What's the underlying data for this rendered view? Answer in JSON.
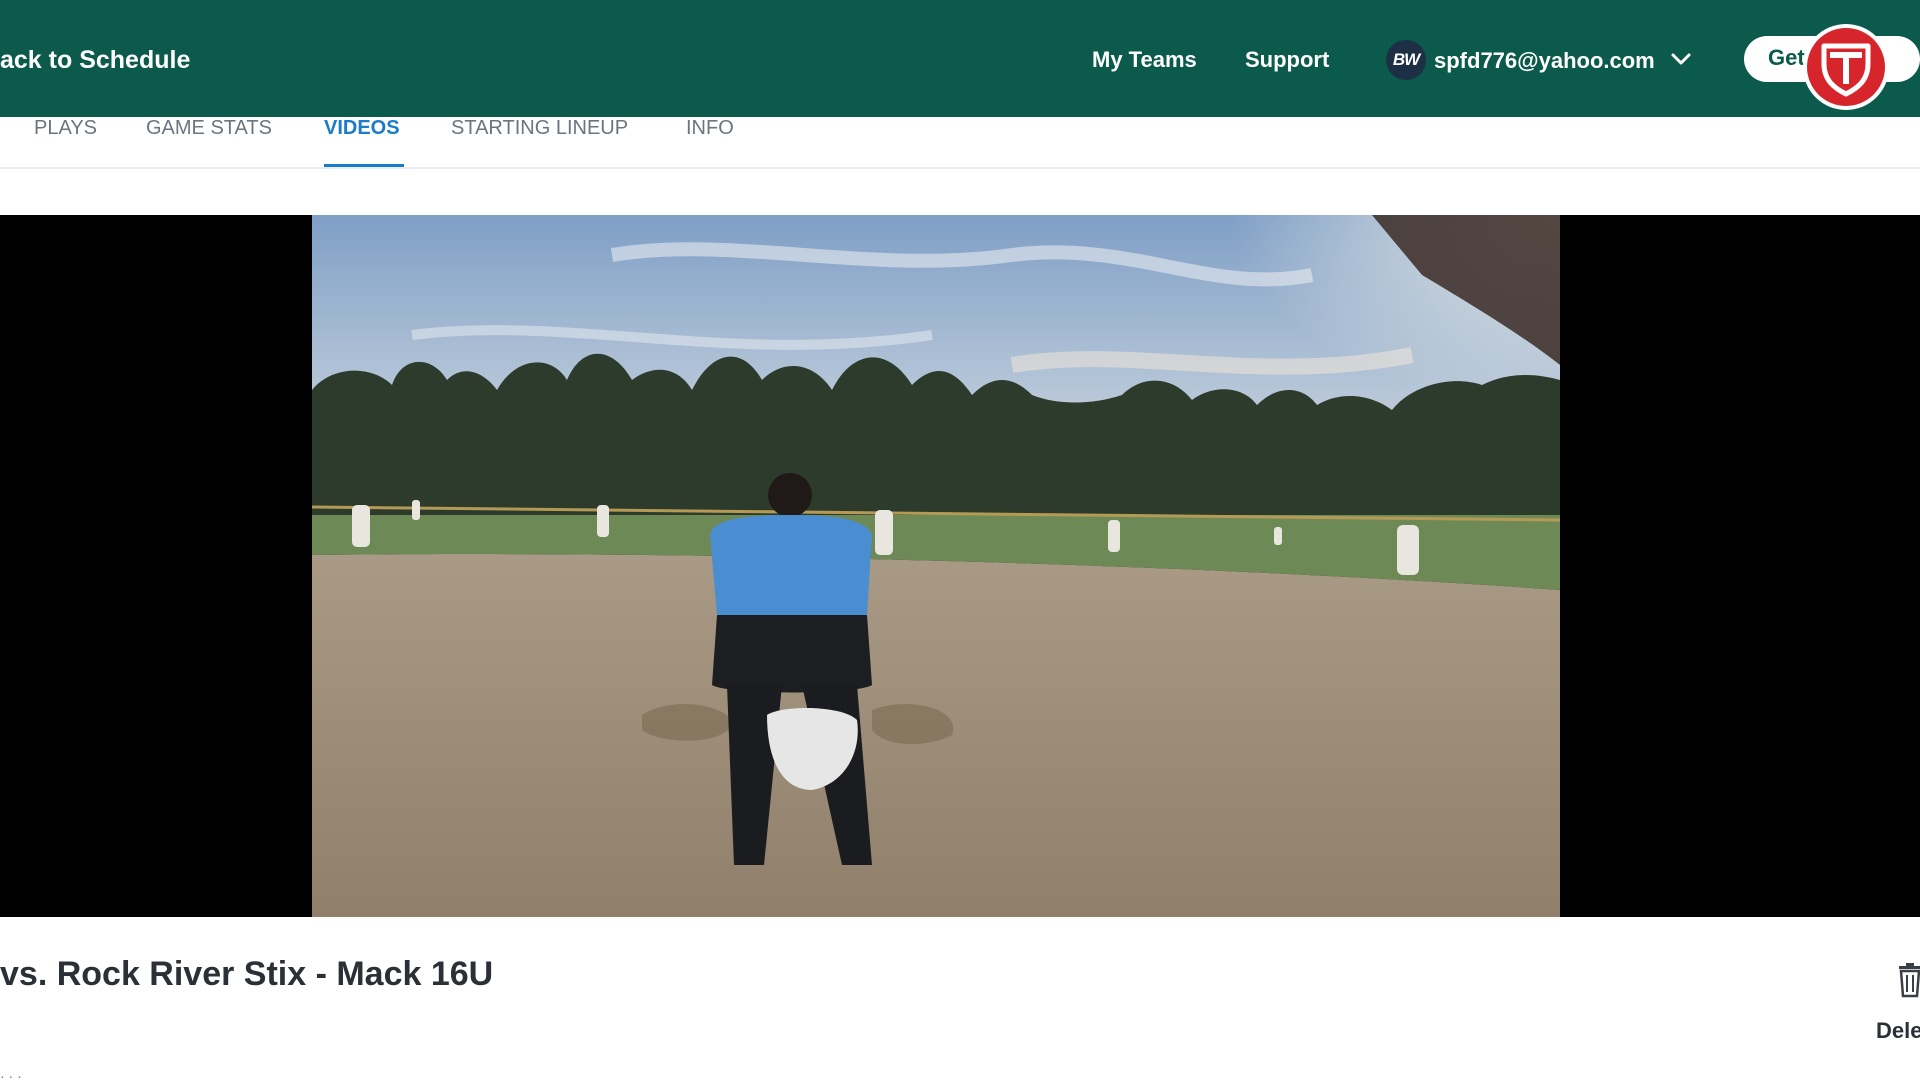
{
  "header": {
    "back_label": "ack to Schedule",
    "nav": [
      "My Teams",
      "Support"
    ],
    "user": {
      "initials": "BW",
      "email": "spfd776@yahoo.com"
    },
    "cta_label": "Get",
    "badge_icon": "shield-logo-icon"
  },
  "tabs": [
    {
      "label": "PLAYS",
      "active": false
    },
    {
      "label": "GAME STATS",
      "active": false
    },
    {
      "label": "VIDEOS",
      "active": true
    },
    {
      "label": "STARTING LINEUP",
      "active": false
    },
    {
      "label": "INFO",
      "active": false
    }
  ],
  "video": {
    "scene": "softball-game-umpire-behind-home-plate"
  },
  "game": {
    "title": "vs. Rock River Stix - Mack 16U",
    "delete_label": "Dele",
    "meta": "· · ·"
  },
  "colors": {
    "header_bg": "#0b5a4c",
    "tab_active": "#1b7cc8",
    "badge_red": "#d7262b"
  }
}
